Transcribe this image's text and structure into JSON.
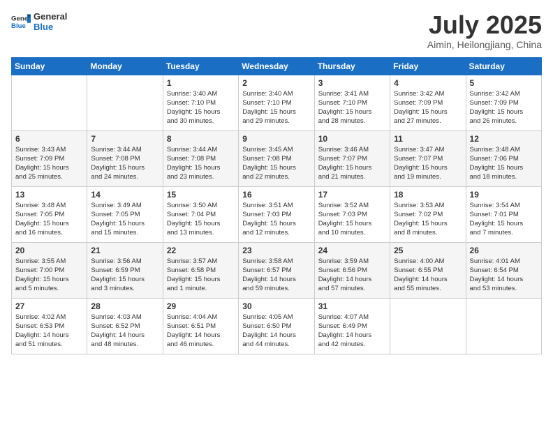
{
  "logo": {
    "general": "General",
    "blue": "Blue"
  },
  "header": {
    "month_year": "July 2025",
    "location": "Aimin, Heilongjiang, China"
  },
  "days_of_week": [
    "Sunday",
    "Monday",
    "Tuesday",
    "Wednesday",
    "Thursday",
    "Friday",
    "Saturday"
  ],
  "weeks": [
    [
      {
        "day": "",
        "detail": ""
      },
      {
        "day": "",
        "detail": ""
      },
      {
        "day": "1",
        "detail": "Sunrise: 3:40 AM\nSunset: 7:10 PM\nDaylight: 15 hours\nand 30 minutes."
      },
      {
        "day": "2",
        "detail": "Sunrise: 3:40 AM\nSunset: 7:10 PM\nDaylight: 15 hours\nand 29 minutes."
      },
      {
        "day": "3",
        "detail": "Sunrise: 3:41 AM\nSunset: 7:10 PM\nDaylight: 15 hours\nand 28 minutes."
      },
      {
        "day": "4",
        "detail": "Sunrise: 3:42 AM\nSunset: 7:09 PM\nDaylight: 15 hours\nand 27 minutes."
      },
      {
        "day": "5",
        "detail": "Sunrise: 3:42 AM\nSunset: 7:09 PM\nDaylight: 15 hours\nand 26 minutes."
      }
    ],
    [
      {
        "day": "6",
        "detail": "Sunrise: 3:43 AM\nSunset: 7:09 PM\nDaylight: 15 hours\nand 25 minutes."
      },
      {
        "day": "7",
        "detail": "Sunrise: 3:44 AM\nSunset: 7:08 PM\nDaylight: 15 hours\nand 24 minutes."
      },
      {
        "day": "8",
        "detail": "Sunrise: 3:44 AM\nSunset: 7:08 PM\nDaylight: 15 hours\nand 23 minutes."
      },
      {
        "day": "9",
        "detail": "Sunrise: 3:45 AM\nSunset: 7:08 PM\nDaylight: 15 hours\nand 22 minutes."
      },
      {
        "day": "10",
        "detail": "Sunrise: 3:46 AM\nSunset: 7:07 PM\nDaylight: 15 hours\nand 21 minutes."
      },
      {
        "day": "11",
        "detail": "Sunrise: 3:47 AM\nSunset: 7:07 PM\nDaylight: 15 hours\nand 19 minutes."
      },
      {
        "day": "12",
        "detail": "Sunrise: 3:48 AM\nSunset: 7:06 PM\nDaylight: 15 hours\nand 18 minutes."
      }
    ],
    [
      {
        "day": "13",
        "detail": "Sunrise: 3:48 AM\nSunset: 7:05 PM\nDaylight: 15 hours\nand 16 minutes."
      },
      {
        "day": "14",
        "detail": "Sunrise: 3:49 AM\nSunset: 7:05 PM\nDaylight: 15 hours\nand 15 minutes."
      },
      {
        "day": "15",
        "detail": "Sunrise: 3:50 AM\nSunset: 7:04 PM\nDaylight: 15 hours\nand 13 minutes."
      },
      {
        "day": "16",
        "detail": "Sunrise: 3:51 AM\nSunset: 7:03 PM\nDaylight: 15 hours\nand 12 minutes."
      },
      {
        "day": "17",
        "detail": "Sunrise: 3:52 AM\nSunset: 7:03 PM\nDaylight: 15 hours\nand 10 minutes."
      },
      {
        "day": "18",
        "detail": "Sunrise: 3:53 AM\nSunset: 7:02 PM\nDaylight: 15 hours\nand 8 minutes."
      },
      {
        "day": "19",
        "detail": "Sunrise: 3:54 AM\nSunset: 7:01 PM\nDaylight: 15 hours\nand 7 minutes."
      }
    ],
    [
      {
        "day": "20",
        "detail": "Sunrise: 3:55 AM\nSunset: 7:00 PM\nDaylight: 15 hours\nand 5 minutes."
      },
      {
        "day": "21",
        "detail": "Sunrise: 3:56 AM\nSunset: 6:59 PM\nDaylight: 15 hours\nand 3 minutes."
      },
      {
        "day": "22",
        "detail": "Sunrise: 3:57 AM\nSunset: 6:58 PM\nDaylight: 15 hours\nand 1 minute."
      },
      {
        "day": "23",
        "detail": "Sunrise: 3:58 AM\nSunset: 6:57 PM\nDaylight: 14 hours\nand 59 minutes."
      },
      {
        "day": "24",
        "detail": "Sunrise: 3:59 AM\nSunset: 6:56 PM\nDaylight: 14 hours\nand 57 minutes."
      },
      {
        "day": "25",
        "detail": "Sunrise: 4:00 AM\nSunset: 6:55 PM\nDaylight: 14 hours\nand 55 minutes."
      },
      {
        "day": "26",
        "detail": "Sunrise: 4:01 AM\nSunset: 6:54 PM\nDaylight: 14 hours\nand 53 minutes."
      }
    ],
    [
      {
        "day": "27",
        "detail": "Sunrise: 4:02 AM\nSunset: 6:53 PM\nDaylight: 14 hours\nand 51 minutes."
      },
      {
        "day": "28",
        "detail": "Sunrise: 4:03 AM\nSunset: 6:52 PM\nDaylight: 14 hours\nand 48 minutes."
      },
      {
        "day": "29",
        "detail": "Sunrise: 4:04 AM\nSunset: 6:51 PM\nDaylight: 14 hours\nand 46 minutes."
      },
      {
        "day": "30",
        "detail": "Sunrise: 4:05 AM\nSunset: 6:50 PM\nDaylight: 14 hours\nand 44 minutes."
      },
      {
        "day": "31",
        "detail": "Sunrise: 4:07 AM\nSunset: 6:49 PM\nDaylight: 14 hours\nand 42 minutes."
      },
      {
        "day": "",
        "detail": ""
      },
      {
        "day": "",
        "detail": ""
      }
    ]
  ]
}
